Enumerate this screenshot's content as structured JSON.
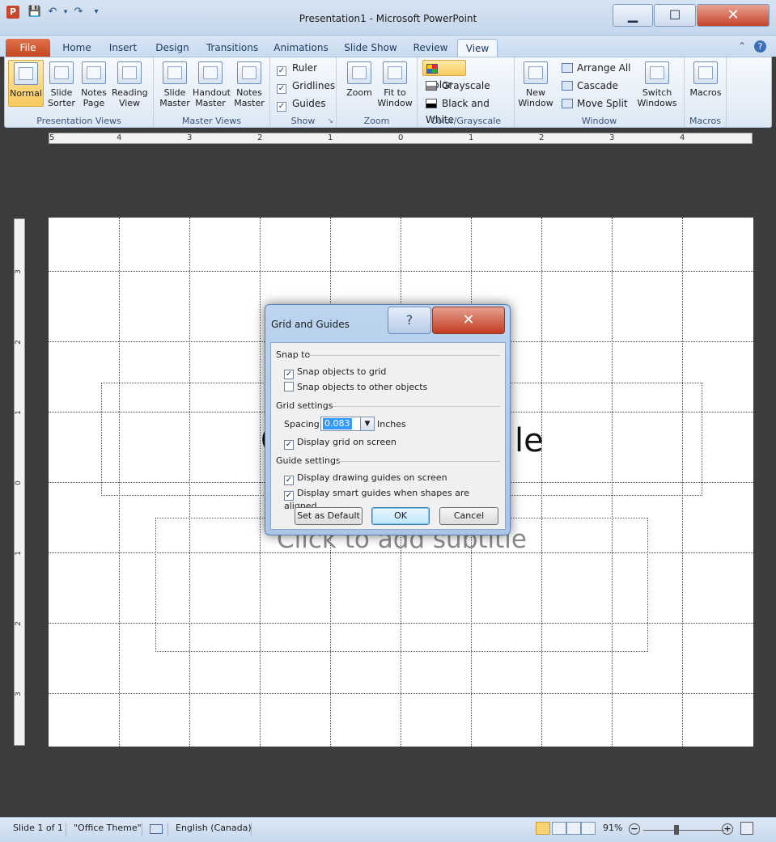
{
  "window": {
    "title": "Presentation1  -  Microsoft PowerPoint",
    "app_icon": "P",
    "minimize_icon": "minimize-icon",
    "maximize_icon": "maximize-icon",
    "close_icon": "close-icon",
    "min_glyph": "▁",
    "max_glyph": "☐",
    "close_glyph": "✕"
  },
  "quick_access": {
    "save": "💾",
    "undo": "↶",
    "undo_drop": "▾",
    "redo": "↷",
    "customize": "▾"
  },
  "tabs": [
    {
      "label": "File"
    },
    {
      "label": "Home"
    },
    {
      "label": "Insert"
    },
    {
      "label": "Design"
    },
    {
      "label": "Transitions"
    },
    {
      "label": "Animations"
    },
    {
      "label": "Slide Show"
    },
    {
      "label": "Review"
    },
    {
      "label": "View"
    }
  ],
  "tab_right": {
    "collapse": "⌃",
    "help": "?"
  },
  "ribbon": {
    "groups": [
      {
        "label": "Presentation Views"
      },
      {
        "label": "Master Views"
      },
      {
        "label": "Show"
      },
      {
        "label": "Zoom"
      },
      {
        "label": "Color/Grayscale"
      },
      {
        "label": "Window"
      },
      {
        "label": "Macros"
      }
    ],
    "presentation_views": [
      {
        "label": "Normal"
      },
      {
        "label": "Slide Sorter"
      },
      {
        "label": "Notes Page"
      },
      {
        "label": "Reading View"
      }
    ],
    "master_views": [
      {
        "label": "Slide Master"
      },
      {
        "label": "Handout Master"
      },
      {
        "label": "Notes Master"
      }
    ],
    "show": [
      {
        "label": "Ruler",
        "checked": "✓"
      },
      {
        "label": "Gridlines",
        "checked": "✓"
      },
      {
        "label": "Guides",
        "checked": "✓"
      }
    ],
    "zoom": [
      {
        "label": "Zoom"
      },
      {
        "label": "Fit to Window"
      }
    ],
    "color": [
      {
        "label": "Color",
        "swatch": "#e9b23a"
      },
      {
        "label": "Grayscale",
        "swatch": "#808080"
      },
      {
        "label": "Black and White",
        "swatch": "#000000"
      }
    ],
    "window": {
      "new_window": "New Window",
      "arrange_all": "Arrange All",
      "cascade": "Cascade",
      "move_split": "Move Split",
      "switch_windows": "Switch Windows"
    },
    "macros": "Macros",
    "dialog_launcher": "↘"
  },
  "ruler": {
    "h_numbers": [
      "5",
      "4",
      "3",
      "2",
      "1",
      "0",
      "1",
      "2",
      "3",
      "4"
    ],
    "v_numbers": [
      "3",
      "2",
      "1",
      "0",
      "1",
      "2",
      "3"
    ]
  },
  "slide": {
    "title_partial_left": "C",
    "title_partial_right": "le",
    "subtitle": "Click to add subtitle"
  },
  "dialog": {
    "title": "Grid and Guides",
    "help": "?",
    "close": "✕",
    "snap_section": "Snap to",
    "snap_grid": "Snap objects to grid",
    "snap_grid_checked": "✓",
    "snap_other": "Snap objects to other objects",
    "snap_other_checked": "",
    "grid_section": "Grid settings",
    "spacing_label": "Spacing:",
    "spacing_value": "0.083",
    "spacing_unit": "Inches",
    "display_grid": "Display grid on screen",
    "display_grid_checked": "✓",
    "guide_section": "Guide settings",
    "display_guides": "Display drawing guides on screen",
    "display_guides_checked": "✓",
    "smart_guides": "Display smart guides when shapes are aligned",
    "smart_guides_checked": "✓",
    "btn_default": "Set as Default",
    "btn_ok": "OK",
    "btn_cancel": "Cancel",
    "drop_glyph": "▼"
  },
  "status": {
    "slide": "Slide 1 of 1",
    "theme": "\"Office Theme\"",
    "language": "English (Canada)",
    "zoom": "91%",
    "zoom_out": "−",
    "zoom_in": "+"
  }
}
